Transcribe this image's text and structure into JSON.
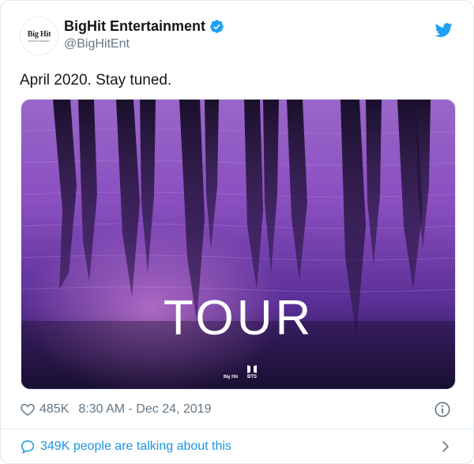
{
  "author": {
    "display_name": "BigHit Entertainment",
    "handle": "@BigHitEnt",
    "avatar_logo": "Big Hit",
    "avatar_subtext": "ENTERTAINMENT",
    "verified": true
  },
  "tweet": {
    "text": "April 2020. Stay tuned."
  },
  "media": {
    "overlay_title": "TOUR",
    "corner_logos": [
      "Big Hit",
      "BTS"
    ]
  },
  "meta": {
    "likes": "485K",
    "timestamp": "8:30 AM - Dec 24, 2019"
  },
  "footer": {
    "conversation_text": "349K people are talking about this"
  },
  "icons": {
    "brand": "twitter-bird-icon",
    "verified": "verified-badge-icon",
    "like": "heart-icon",
    "info": "info-icon",
    "conversation": "comment-icon",
    "chevron": "chevron-right-icon"
  },
  "colors": {
    "twitter_blue": "#1da1f2",
    "link_blue": "#1b95e0",
    "text": "#14171a",
    "secondary": "#657786",
    "border": "#e1e8ed"
  }
}
